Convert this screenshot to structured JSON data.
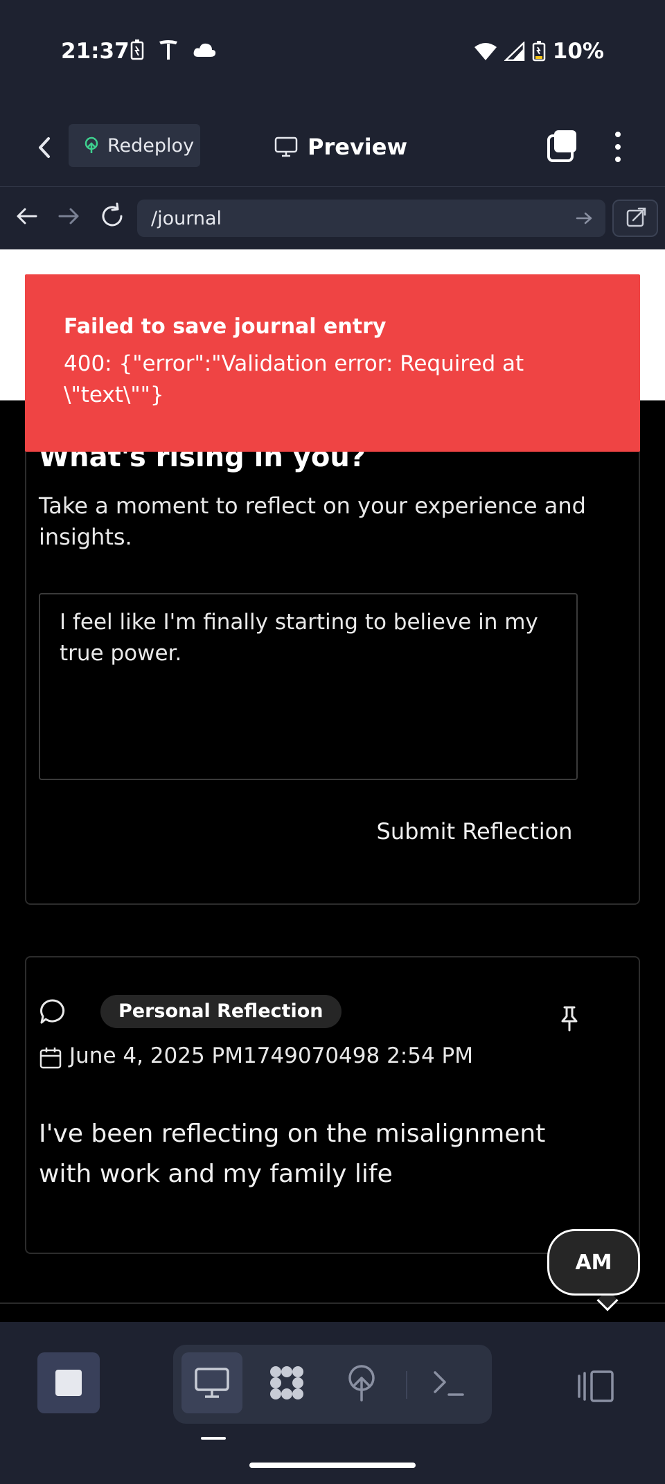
{
  "status_bar": {
    "time": "21:37",
    "battery": "10%"
  },
  "header": {
    "redeploy_label": "Redeploy",
    "preview_label": "Preview"
  },
  "url_bar": {
    "path": "/journal"
  },
  "toast": {
    "title": "Failed to save journal entry",
    "message": "400: {\"error\":\"Validation error: Required at \\\"text\\\"\"}"
  },
  "reflection_card": {
    "title": "What's rising in you?",
    "description": "Take a moment to reflect on your experience and insights.",
    "input_value": "I feel like I'm finally starting to believe in my true power.",
    "submit_label": "Submit Reflection"
  },
  "entry_card": {
    "tag": "Personal Reflection",
    "date": "June 4, 2025 PM1749070498 2:54 PM",
    "text": "I've been reflecting on the misalignment with work and my family life"
  },
  "avatar_bubble": {
    "initials": "AM"
  },
  "icons": {
    "status_left": [
      "battery-charging-icon",
      "tesla-icon",
      "cloud-icon"
    ],
    "status_right": [
      "wifi-icon",
      "signal-icon",
      "battery-icon"
    ],
    "toolbar": [
      "stop-icon",
      "desktop-icon",
      "grid-icon",
      "deploy-icon",
      "terminal-icon",
      "layout-icon"
    ]
  },
  "colors": {
    "error": "#ef4444",
    "chrome": "#1e2230",
    "page_bg": "#000000"
  }
}
